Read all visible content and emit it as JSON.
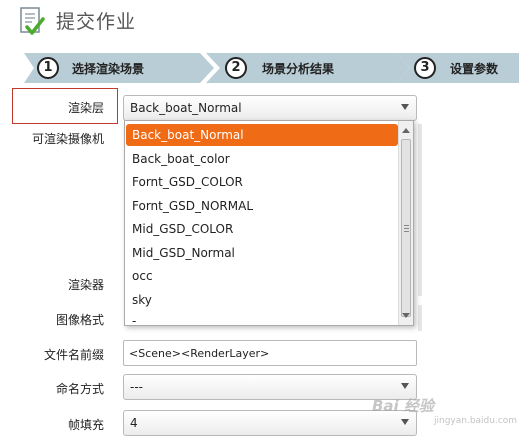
{
  "header": {
    "title": "提交作业",
    "icon": "document-check-icon"
  },
  "steps": [
    {
      "number": "1",
      "label": "选择渲染场景"
    },
    {
      "number": "2",
      "label": "场景分析结果"
    },
    {
      "number": "3",
      "label": "设置参数"
    }
  ],
  "form": {
    "render_layer": {
      "label": "渲染层",
      "value": "Back_boat_Normal"
    },
    "renderable_camera": {
      "label": "可渲染摄像机"
    },
    "renderer": {
      "label": "渲染器"
    },
    "image_format": {
      "label": "图像格式"
    },
    "file_prefix": {
      "label": "文件名前缀",
      "value": "<Scene><RenderLayer>"
    },
    "naming": {
      "label": "命名方式",
      "value": "---"
    },
    "frame_padding": {
      "label": "帧填充",
      "value": "4"
    }
  },
  "dropdown": {
    "options": [
      "Back_boat_Normal",
      "Back_boat_color",
      "Fornt_GSD_COLOR",
      "Fornt_GSD_NORMAL",
      "Mid_GSD_COLOR",
      "Mid_GSD_Normal",
      "occ",
      "sky",
      "-"
    ],
    "selected_index": 0
  },
  "colors": {
    "selected": "#f06b16",
    "step_bar": "#b9cdd6",
    "highlight_border": "#c0392b"
  },
  "watermark": {
    "text": "Bai 经验",
    "sub": "jingyan.baidu.com"
  }
}
